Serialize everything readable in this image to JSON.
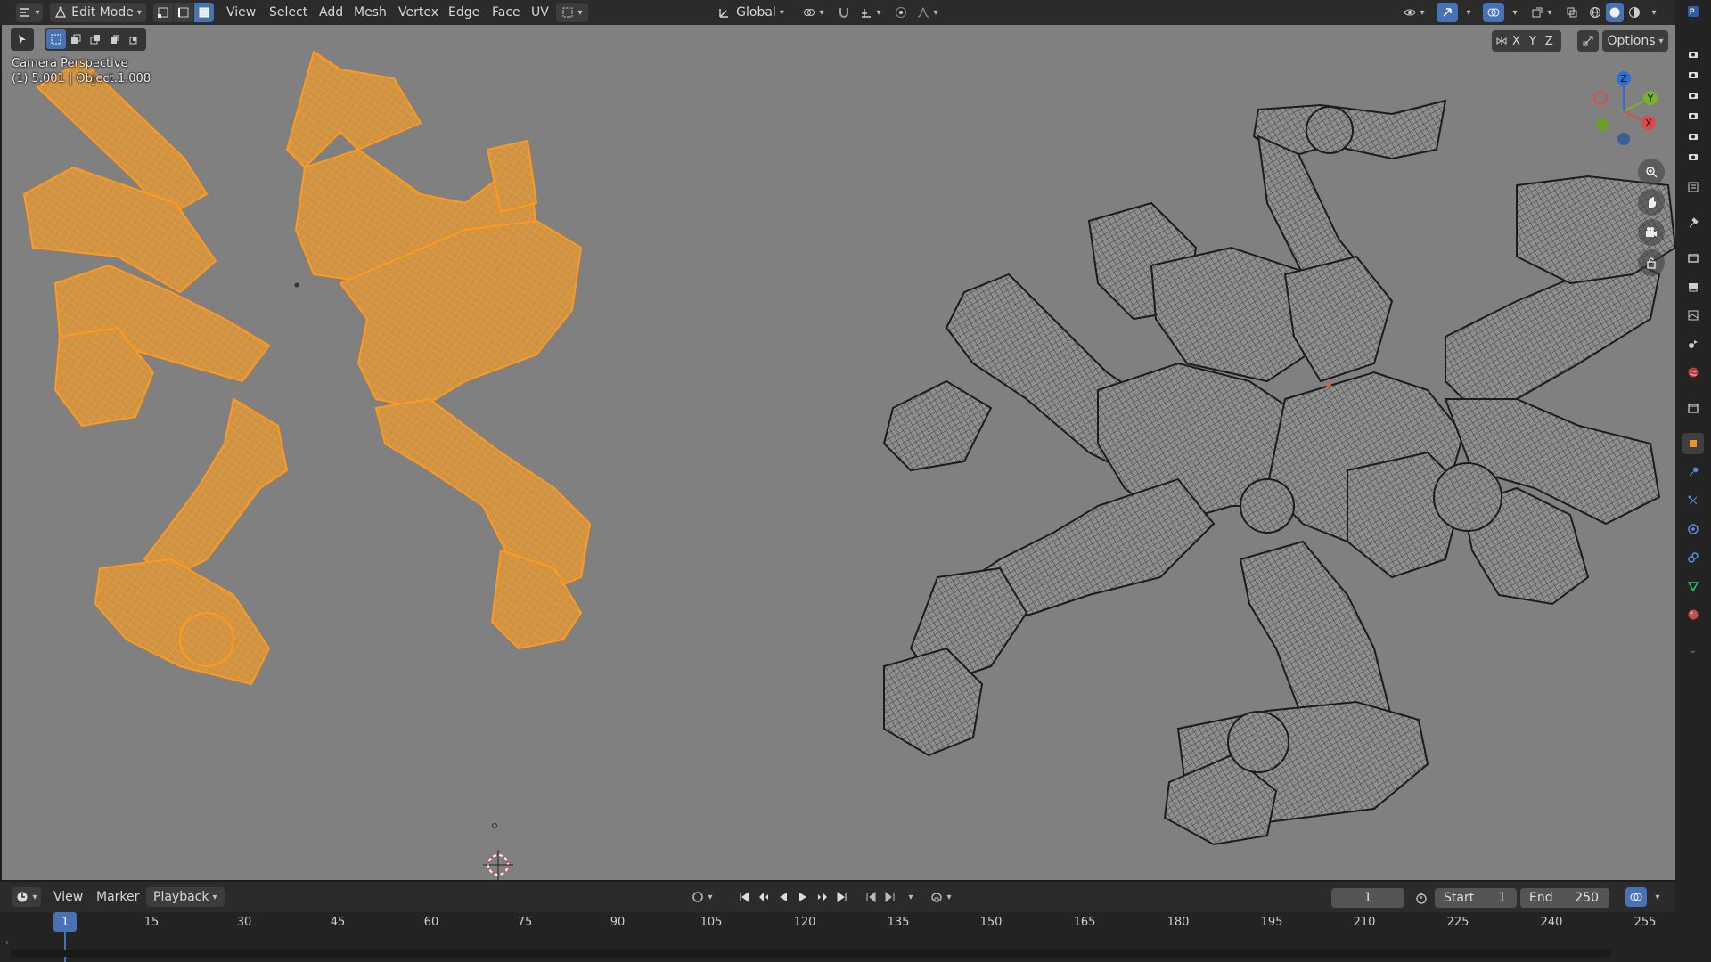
{
  "header": {
    "mode_label": "Edit Mode",
    "menus": [
      "View",
      "Select",
      "Add",
      "Mesh",
      "Vertex",
      "Edge",
      "Face",
      "UV"
    ],
    "orientation_label": "Global",
    "options_label": "Options",
    "axis_locks": [
      "X",
      "Y",
      "Z"
    ]
  },
  "viewport": {
    "view_name": "Camera Perspective",
    "object_info": "(1) 5.001 | Object.1.008",
    "gizmo_axes": {
      "z": "Z",
      "y": "Y",
      "x": "X"
    },
    "colors": {
      "background": "#808080",
      "selected_mesh": "#f5a12c",
      "unselected_mesh": "#1c1c1c",
      "mesh_fill": "#8e8e8e"
    }
  },
  "timeline": {
    "menus": [
      "View",
      "Marker",
      "Playback"
    ],
    "current_frame": "1",
    "start_label": "Start",
    "start_value": "1",
    "end_label": "End",
    "end_value": "250",
    "ticks": [
      "15",
      "30",
      "45",
      "60",
      "75",
      "90",
      "105",
      "120",
      "135",
      "150",
      "165",
      "180",
      "195",
      "210",
      "225",
      "240",
      "255"
    ],
    "playhead_frame": "1"
  },
  "icons": {
    "properties_tabs": [
      "tool-icon",
      "render-icon",
      "output-icon",
      "view-layer-icon",
      "scene-icon",
      "world-icon",
      "collection-icon",
      "object-icon",
      "modifier-icon",
      "particles-icon",
      "physics-icon",
      "constraints-icon",
      "data-icon",
      "material-icon"
    ]
  }
}
